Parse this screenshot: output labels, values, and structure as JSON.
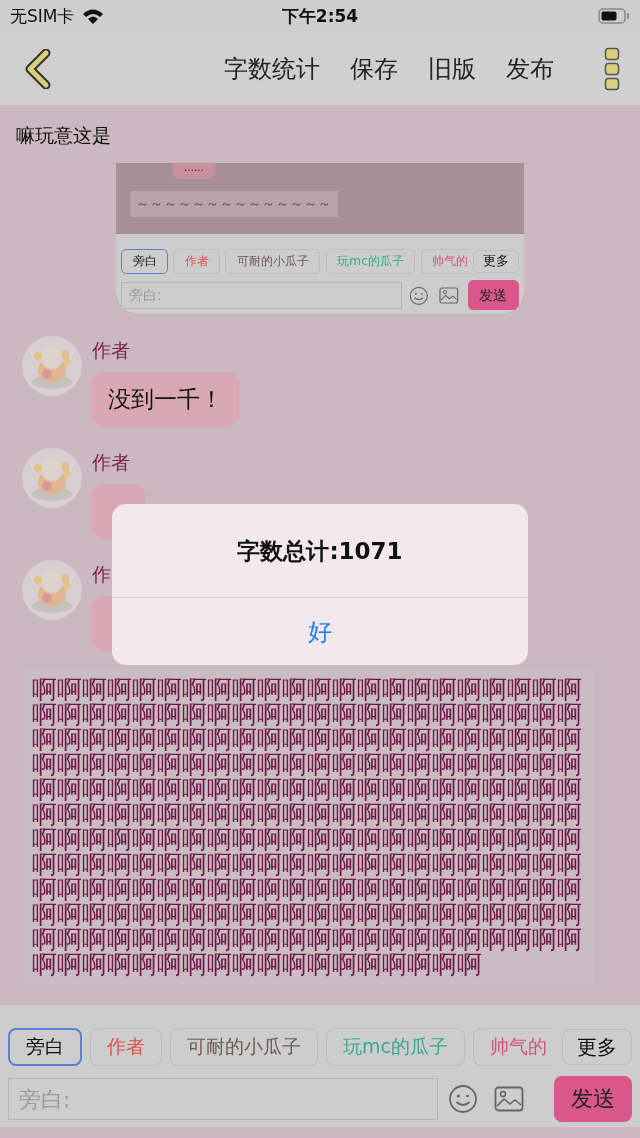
{
  "status_bar": {
    "carrier": "无SIM卡",
    "time": "下午2:54"
  },
  "nav": {
    "actions": [
      "字数统计",
      "保存",
      "旧版",
      "发布"
    ]
  },
  "chapter_title": "嘛玩意这是",
  "embedded_screenshot": {
    "bubble": "……",
    "narration": "～～～～～～～～～～～～～～",
    "composer": {
      "tags": [
        {
          "label": "旁白",
          "selected": true
        },
        {
          "label": "作者",
          "selected": false,
          "color": "#d9534f"
        },
        {
          "label": "可耐的小瓜子",
          "selected": false,
          "color": "#6b5a55"
        },
        {
          "label": "玩mc的瓜子",
          "selected": false,
          "color": "#3aa88c"
        },
        {
          "label": "帅气的",
          "selected": false,
          "color": "#d2557f"
        }
      ],
      "more": "更多",
      "input": {
        "placeholder": "旁白:"
      },
      "send": "发送"
    }
  },
  "messages": [
    {
      "kind": "bubble",
      "sender": "作者",
      "text": "没到一千！"
    },
    {
      "kind": "bubble",
      "sender": "作者"
    },
    {
      "kind": "bubble",
      "sender": "作"
    },
    {
      "kind": "narration",
      "text": "啊啊啊啊啊啊啊啊啊啊啊啊啊啊啊啊啊啊啊啊啊啊啊啊啊啊啊啊啊啊啊啊啊啊啊啊啊啊啊啊啊啊啊啊啊啊啊啊啊啊啊啊啊啊啊啊啊啊啊啊啊啊啊啊啊啊啊啊啊啊啊啊啊啊啊啊啊啊啊啊啊啊啊啊啊啊啊啊啊啊啊啊啊啊啊啊啊啊啊啊啊啊啊啊啊啊啊啊啊啊啊啊啊啊啊啊啊啊啊啊啊啊啊啊啊啊啊啊啊啊啊啊啊啊啊啊啊啊啊啊啊啊啊啊啊啊啊啊啊啊啊啊啊啊啊啊啊啊啊啊啊啊啊啊啊啊啊啊啊啊啊啊啊啊啊啊啊啊啊啊啊啊啊啊啊啊啊啊啊啊啊啊啊啊啊啊啊啊啊啊啊啊啊啊啊啊啊啊啊啊啊啊啊啊啊啊啊啊啊啊啊啊啊啊啊啊啊啊啊啊啊啊啊啊啊啊啊啊啊啊啊啊啊啊啊啊啊啊啊啊啊啊啊啊啊啊啊啊啊啊"
    }
  ],
  "alert": {
    "message": "字数总计:1071",
    "button": "好"
  },
  "composer": {
    "tags": [
      {
        "label": "旁白",
        "selected": true
      },
      {
        "label": "作者",
        "selected": false,
        "color": "#d9534f"
      },
      {
        "label": "可耐的小瓜子",
        "selected": false,
        "color": "#6b5a55"
      },
      {
        "label": "玩mc的瓜子",
        "selected": false,
        "color": "#3aa88c"
      },
      {
        "label": "帅气的",
        "selected": false,
        "color": "#d2557f"
      }
    ],
    "more": "更多",
    "input": {
      "placeholder": "旁白:"
    },
    "send": "发送"
  }
}
